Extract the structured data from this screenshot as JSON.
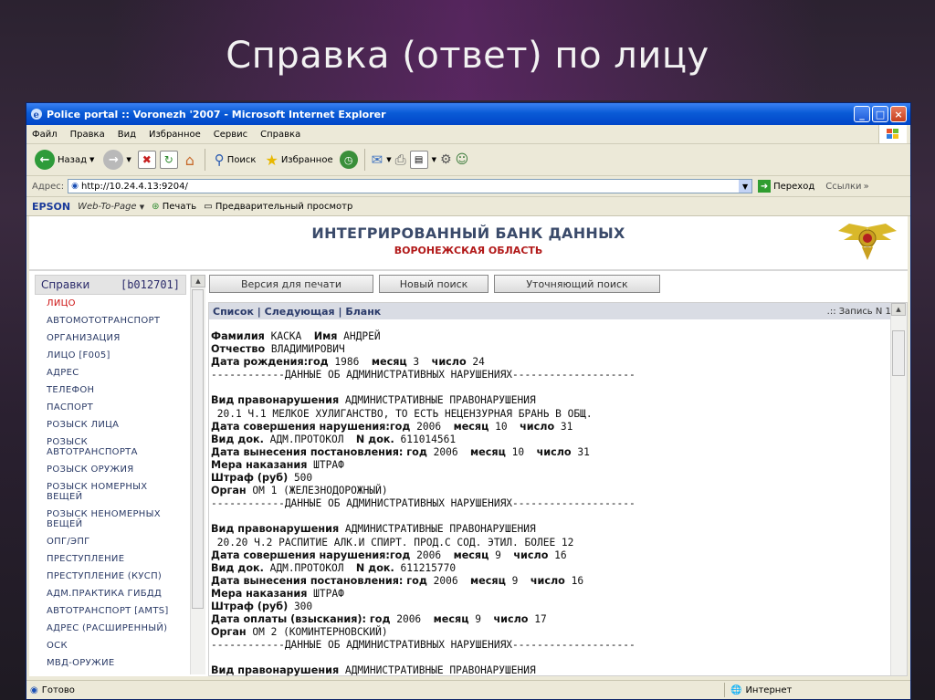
{
  "slide": {
    "title": "Справка (ответ)  по лицу"
  },
  "window": {
    "title": "Police portal :: Voronezh '2007 - Microsoft Internet Explorer",
    "controls": {
      "minimize": "_",
      "maximize": "□",
      "close": "×"
    }
  },
  "menu": [
    "Файл",
    "Правка",
    "Вид",
    "Избранное",
    "Сервис",
    "Справка"
  ],
  "toolbar": {
    "back": "Назад",
    "search": "Поиск",
    "favorites": "Избранное"
  },
  "address": {
    "label": "Адрес:",
    "url": "http://10.24.4.13:9204/",
    "go": "Переход",
    "links": "Ссылки"
  },
  "epsonbar": {
    "epson": "EPSON",
    "web_to_page": "Web-To-Page",
    "print": "Печать",
    "preview": "Предварительный просмотр"
  },
  "page": {
    "header_title": "ИНТЕГРИРОВАННЫЙ БАНК ДАННЫХ",
    "header_subtitle": "ВОРОНЕЖСКАЯ ОБЛАСТЬ"
  },
  "sidebar": {
    "title": "Справки",
    "code": "[b012701]",
    "items": [
      "ЛИЦО",
      "АВТОМОТОТРАНСПОРТ",
      "ОРГАНИЗАЦИЯ",
      "ЛИЦО [F005]",
      "АДРЕС",
      "ТЕЛЕФОН",
      "ПАСПОРТ",
      "РОЗЫСК ЛИЦА",
      "РОЗЫСК\nАВТОТРАНСПОРТА",
      "РОЗЫСК ОРУЖИЯ",
      "РОЗЫСК НОМЕРНЫХ\nВЕЩЕЙ",
      "РОЗЫСК НЕНОМЕРНЫХ\nВЕЩЕЙ",
      "ОПГ/ЭПГ",
      "ПРЕСТУПЛЕНИЕ",
      "ПРЕСТУПЛЕНИЕ (КУСП)",
      "АДМ.ПРАКТИКА ГИБДД",
      "АВТОТРАНСПОРТ [AMTS]",
      "АДРЕС (РАСШИРЕННЫЙ)",
      "ОСК",
      "МВД-ОРУЖИЕ"
    ]
  },
  "buttons": {
    "print_version": "Версия для печати",
    "new_search": "Новый поиск",
    "refine_search": "Уточняющий поиск"
  },
  "nav": {
    "list": "Список",
    "next": "Следующая",
    "blank": "Бланк",
    "record": ".:: Запись N 1 ::."
  },
  "record": {
    "lines": [
      [
        {
          "b": "Фамилия"
        },
        {
          "t": " КАСКА  "
        },
        {
          "b": "Имя"
        },
        {
          "t": " АНДРЕЙ"
        }
      ],
      [
        {
          "b": "Отчество"
        },
        {
          "t": " ВЛАДИМИРОВИЧ"
        }
      ],
      [
        {
          "b": "Дата рождения:год"
        },
        {
          "t": " 1986  "
        },
        {
          "b": "месяц"
        },
        {
          "t": " 3  "
        },
        {
          "b": "число"
        },
        {
          "t": " 24"
        }
      ],
      [
        {
          "t": "------------ДАННЫЕ ОБ АДМИНИСТРАТИВНЫХ НАРУШЕНИЯХ--------------------"
        }
      ],
      [
        {
          "t": ""
        }
      ],
      [
        {
          "b": "Вид правонарушения"
        },
        {
          "t": " АДМИНИСТРАТИВНЫЕ ПРАВОНАРУШЕНИЯ"
        }
      ],
      [
        {
          "t": " 20.1 Ч.1 МЕЛКОЕ ХУЛИГАНСТВО, ТО ЕСТЬ НЕЦЕНЗУРНАЯ БРАНЬ В ОБЩ."
        }
      ],
      [
        {
          "b": "Дата совершения нарушения:год"
        },
        {
          "t": " 2006  "
        },
        {
          "b": "месяц"
        },
        {
          "t": " 10  "
        },
        {
          "b": "число"
        },
        {
          "t": " 31"
        }
      ],
      [
        {
          "b": "Вид док."
        },
        {
          "t": " АДМ.ПРОТОКОЛ  "
        },
        {
          "b": "N док."
        },
        {
          "t": " 611014561"
        }
      ],
      [
        {
          "b": "Дата вынесения постановления: год"
        },
        {
          "t": " 2006  "
        },
        {
          "b": "месяц"
        },
        {
          "t": " 10  "
        },
        {
          "b": "число"
        },
        {
          "t": " 31"
        }
      ],
      [
        {
          "b": "Мера наказания"
        },
        {
          "t": " ШТРАФ"
        }
      ],
      [
        {
          "b": "Штраф (руб)"
        },
        {
          "t": " 500"
        }
      ],
      [
        {
          "b": "Орган"
        },
        {
          "t": " ОМ 1 (ЖЕЛЕЗНОДОРОЖНЫЙ)"
        }
      ],
      [
        {
          "t": "------------ДАННЫЕ ОБ АДМИНИСТРАТИВНЫХ НАРУШЕНИЯХ--------------------"
        }
      ],
      [
        {
          "t": ""
        }
      ],
      [
        {
          "b": "Вид правонарушения"
        },
        {
          "t": " АДМИНИСТРАТИВНЫЕ ПРАВОНАРУШЕНИЯ"
        }
      ],
      [
        {
          "t": " 20.20 Ч.2 РАСПИТИЕ АЛК.И СПИРТ. ПРОД.С СОД. ЭТИЛ. БОЛЕЕ 12"
        }
      ],
      [
        {
          "b": "Дата совершения нарушения:год"
        },
        {
          "t": " 2006  "
        },
        {
          "b": "месяц"
        },
        {
          "t": " 9  "
        },
        {
          "b": "число"
        },
        {
          "t": " 16"
        }
      ],
      [
        {
          "b": "Вид док."
        },
        {
          "t": " АДМ.ПРОТОКОЛ  "
        },
        {
          "b": "N док."
        },
        {
          "t": " 611215770"
        }
      ],
      [
        {
          "b": "Дата вынесения постановления: год"
        },
        {
          "t": " 2006  "
        },
        {
          "b": "месяц"
        },
        {
          "t": " 9  "
        },
        {
          "b": "число"
        },
        {
          "t": " 16"
        }
      ],
      [
        {
          "b": "Мера наказания"
        },
        {
          "t": " ШТРАФ"
        }
      ],
      [
        {
          "b": "Штраф (руб)"
        },
        {
          "t": " 300"
        }
      ],
      [
        {
          "b": "Дата оплаты (взыскания): год"
        },
        {
          "t": " 2006  "
        },
        {
          "b": "месяц"
        },
        {
          "t": " 9  "
        },
        {
          "b": "число"
        },
        {
          "t": " 17"
        }
      ],
      [
        {
          "b": "Орган"
        },
        {
          "t": " ОМ 2 (КОМИНТЕРНОВСКИЙ)"
        }
      ],
      [
        {
          "t": "------------ДАННЫЕ ОБ АДМИНИСТРАТИВНЫХ НАРУШЕНИЯХ--------------------"
        }
      ],
      [
        {
          "t": ""
        }
      ],
      [
        {
          "b": "Вид правонарушения"
        },
        {
          "t": " АДМИНИСТРАТИВНЫЕ ПРАВОНАРУШЕНИЯ"
        }
      ]
    ]
  },
  "status": {
    "left": "Готово",
    "zone": "Интернет"
  },
  "colors": {
    "title_blue": "#0a5bd6",
    "active_red": "#cc1111",
    "header_text": "#3a4a6a"
  }
}
